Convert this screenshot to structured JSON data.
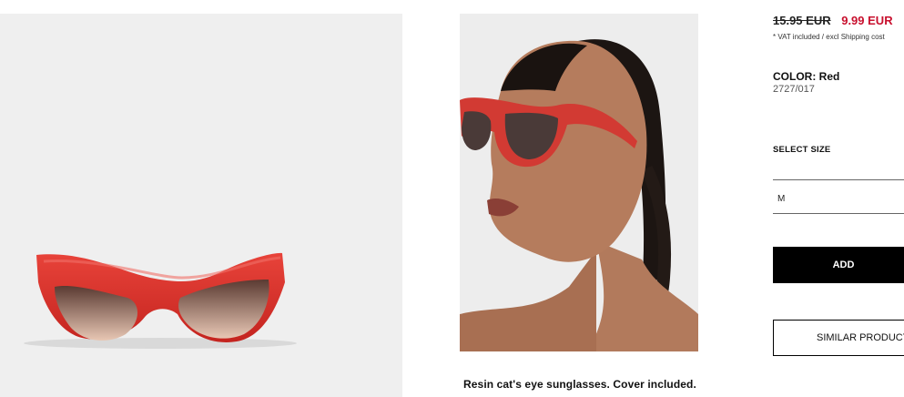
{
  "product": {
    "description": "Resin cat's eye sunglasses. Cover included."
  },
  "price": {
    "old": "15.95 EUR",
    "new": "9.99 EUR",
    "vat_note": "* VAT included / excl Shipping cost"
  },
  "color": {
    "label": "COLOR:",
    "name": "Red",
    "ref": "2727/017"
  },
  "size": {
    "label": "SELECT SIZE",
    "selected": "M"
  },
  "actions": {
    "add_label": "ADD",
    "similar_label": "SIMILAR PRODUCTS"
  },
  "colors": {
    "sale_red": "#c8102e",
    "frame_red": "#d9302c",
    "button_black": "#000000"
  }
}
